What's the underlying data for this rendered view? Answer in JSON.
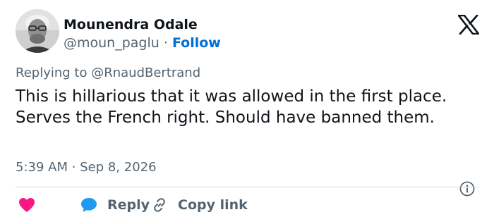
{
  "author": {
    "name": "Mounendra Odale",
    "handle": "@moun_paglu",
    "separator": "·",
    "follow_label": "Follow"
  },
  "tweet": {
    "replying_prefix": "Replying to",
    "replying_to": "@RnaudBertrand",
    "text": "This is hillarious that it was allowed in the first place. Serves the French right. Should have banned them.",
    "time": "5:39 AM",
    "date_separator": "·",
    "date": "Sep 8, 2026"
  },
  "actions": {
    "reply_label": "Reply",
    "copy_label": "Copy link"
  },
  "colors": {
    "accent": "#006fd6",
    "heart": "#f91880",
    "reply_bubble": "#1d9bf0",
    "muted": "#536471"
  },
  "icons": [
    "avatar",
    "x-logo-icon",
    "info-icon",
    "heart-icon",
    "reply-bubble-icon",
    "link-icon"
  ]
}
